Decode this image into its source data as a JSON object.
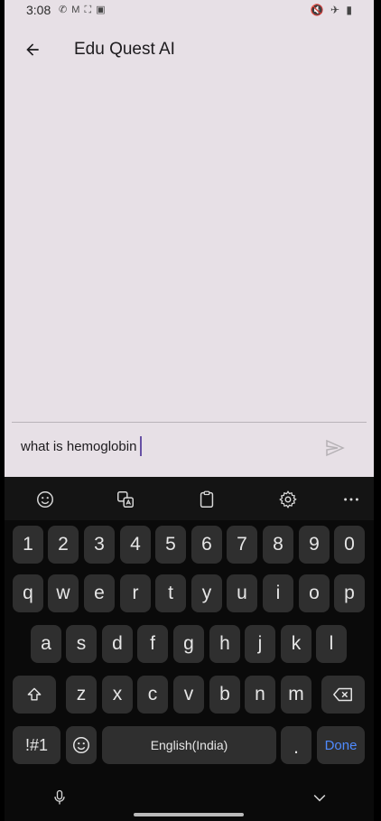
{
  "status_bar": {
    "time": "3:08",
    "left_icons": "✆ M ⛶ ▣",
    "right_icons": "🔇 ✈ ▮"
  },
  "app_bar": {
    "title": "Edu Quest AI"
  },
  "input": {
    "value": "what is hemoglobin"
  },
  "keyboard": {
    "row_numbers": [
      "1",
      "2",
      "3",
      "4",
      "5",
      "6",
      "7",
      "8",
      "9",
      "0"
    ],
    "row_1": [
      "q",
      "w",
      "e",
      "r",
      "t",
      "y",
      "u",
      "i",
      "o",
      "p"
    ],
    "row_2": [
      "a",
      "s",
      "d",
      "f",
      "g",
      "h",
      "j",
      "k",
      "l"
    ],
    "row_3": [
      "z",
      "x",
      "c",
      "v",
      "b",
      "n",
      "m"
    ],
    "symbols_label": "!#1",
    "space_label": "English(India)",
    "period_label": ".",
    "done_label": "Done"
  },
  "colors": {
    "app_background": "#e7e0e6",
    "keyboard_background": "#0a0a0a",
    "key_background": "#2f2f2f",
    "accent": "#6750a4",
    "done_color": "#4f8bff"
  }
}
